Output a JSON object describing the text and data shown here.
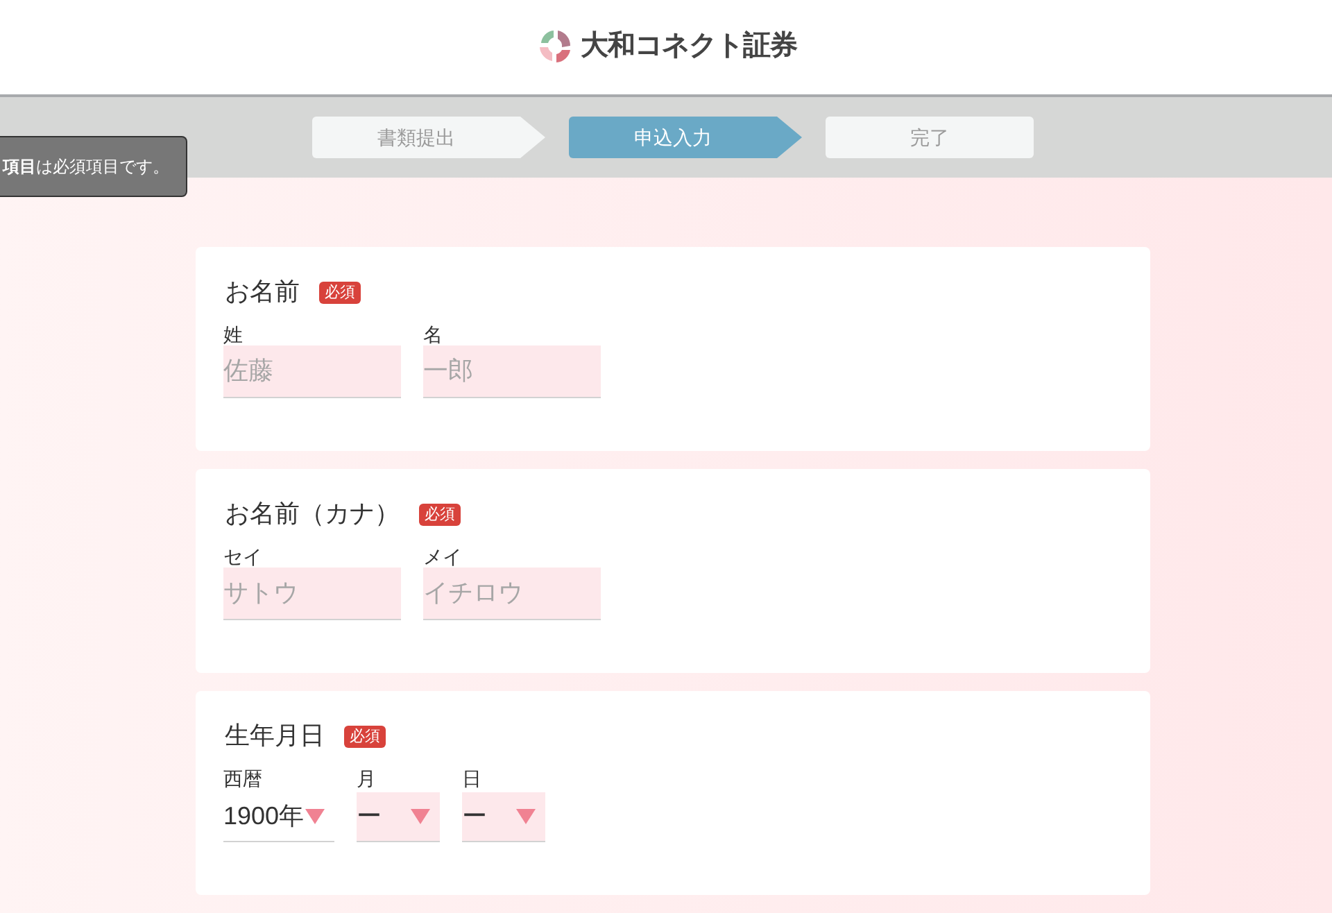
{
  "header": {
    "logo_text": "大和コネクト証券"
  },
  "steps": [
    {
      "label": "書類提出",
      "selected": false
    },
    {
      "label": "申込入力",
      "selected": true
    },
    {
      "label": "完了",
      "selected": false
    }
  ],
  "tooltip": {
    "text": "**項目**は必須項目です。"
  },
  "sections": [
    {
      "title": "お名前",
      "badge": "必須",
      "fields": [
        {
          "kind": "text",
          "label": "姓",
          "placeholder": "佐藤",
          "invalid": true
        },
        {
          "kind": "text",
          "label": "名",
          "placeholder": "一郎",
          "invalid": true
        }
      ]
    },
    {
      "title": "お名前（カナ）",
      "badge": "必須",
      "fields": [
        {
          "kind": "text",
          "label": "セイ",
          "placeholder": "サトウ",
          "invalid": true
        },
        {
          "kind": "text",
          "label": "メイ",
          "placeholder": "イチロウ",
          "invalid": true
        }
      ]
    },
    {
      "title": "生年月日",
      "badge": "必須",
      "fields": [
        {
          "kind": "select",
          "label": "西暦",
          "value": "1900年",
          "invalid": false
        },
        {
          "kind": "select",
          "label": "月",
          "value": "ー",
          "invalid": true
        },
        {
          "kind": "select",
          "label": "日",
          "value": "ー",
          "invalid": true
        }
      ]
    }
  ]
}
